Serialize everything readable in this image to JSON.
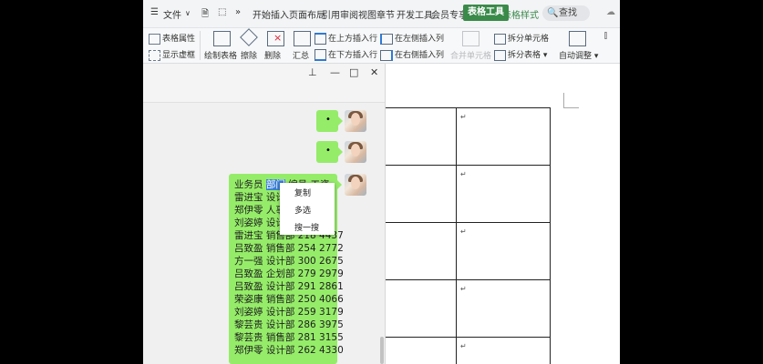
{
  "menubar": {
    "file_label": "文件",
    "tabs": [
      "开始",
      "插入",
      "页面布局",
      "引用",
      "审阅",
      "视图",
      "章节",
      "开发工具",
      "会员专享"
    ],
    "active_tab": "表格工具",
    "extra_tab": "表格样式",
    "search_label": "查找"
  },
  "ribbon": {
    "table_props": "表格属性",
    "show_gridlines": "显示虚框",
    "draw_table": "绘制表格",
    "eraser": "擦除",
    "delete": "删除",
    "summary": "汇总",
    "insert_above": "在上方插入行",
    "insert_below": "在下方插入行",
    "insert_left": "在左侧插入列",
    "insert_right": "在右侧插入列",
    "merge_cells": "合并单元格",
    "split_cells": "拆分单元格",
    "split_table": "拆分表格",
    "auto_fit": "自动调整"
  },
  "chat": {
    "small_bubbles": [
      "•",
      "•"
    ],
    "big_bubble_lines": [
      {
        "pre": "业务员 ",
        "sel": "部门",
        "post": " 编号 工资"
      },
      {
        "pre": "雷进宝 设计部",
        "sel": "",
        "post": ""
      },
      {
        "pre": "郑伊零 人事",
        "sel": "",
        "post": ""
      },
      {
        "pre": "刘姿婷 设计",
        "sel": "",
        "post": ""
      },
      {
        "pre": "雷进宝 销售部 218 4437",
        "sel": "",
        "post": ""
      },
      {
        "pre": "吕致盈 销售部 254 2772",
        "sel": "",
        "post": ""
      },
      {
        "pre": "方一强 设计部 300 2675",
        "sel": "",
        "post": ""
      },
      {
        "pre": "吕致盈 企划部 279 2979",
        "sel": "",
        "post": ""
      },
      {
        "pre": "吕致盈 设计部 291 2861",
        "sel": "",
        "post": ""
      },
      {
        "pre": "荣姿康 销售部 250 4066",
        "sel": "",
        "post": ""
      },
      {
        "pre": "刘姿婷 设计部 259 3179",
        "sel": "",
        "post": ""
      },
      {
        "pre": "黎芸贵 设计部 286 3975",
        "sel": "",
        "post": ""
      },
      {
        "pre": "黎芸贵 销售部 281 3155",
        "sel": "",
        "post": ""
      },
      {
        "pre": "郑伊零 设计部 262 4330",
        "sel": "",
        "post": ""
      }
    ],
    "context_menu": [
      "复制",
      "多选",
      "搜一搜"
    ]
  },
  "document": {
    "paragraph_mark": "↵"
  },
  "colors": {
    "bubble": "#95ec69",
    "active_tab": "#3a8a4a",
    "selection": "#3a7fd5"
  }
}
